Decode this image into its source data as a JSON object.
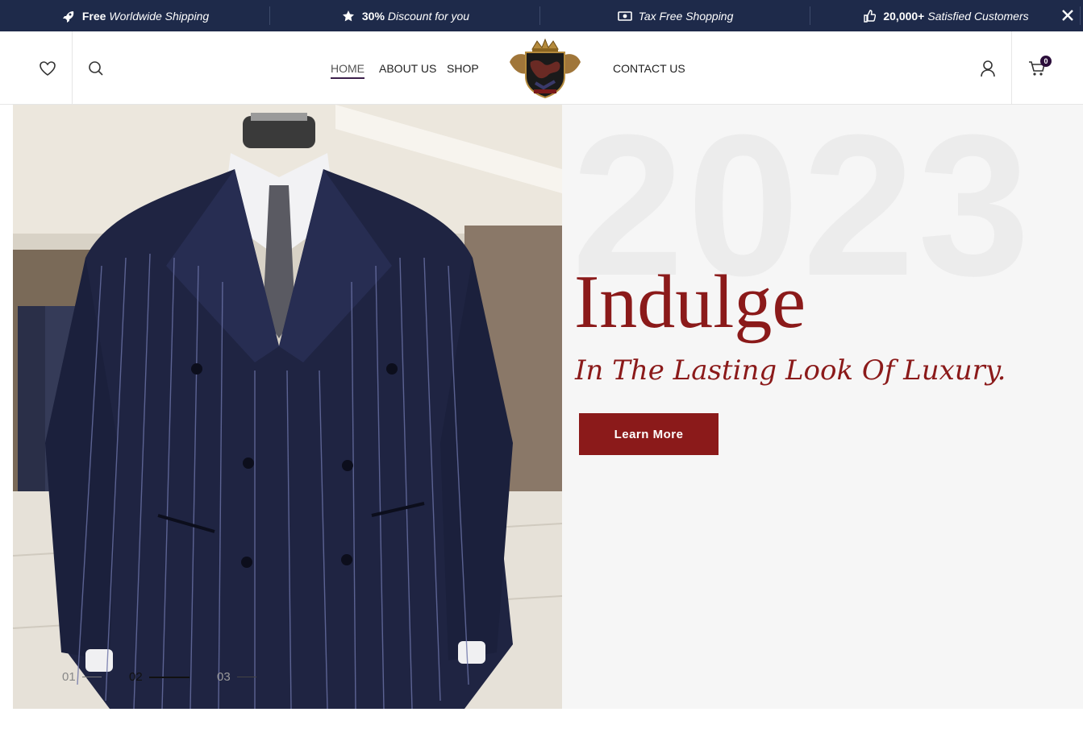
{
  "topbar": {
    "promos": [
      {
        "icon": "rocket-icon",
        "bold": "Free",
        "text": "Worldwide Shipping"
      },
      {
        "icon": "star-icon",
        "bold": "30%",
        "text": "Discount for you"
      },
      {
        "icon": "cash-icon",
        "bold": "",
        "text": "Tax Free Shopping"
      },
      {
        "icon": "thumbs-up-icon",
        "bold": "20,000+",
        "text": "Satisfied Customers"
      }
    ],
    "close_icon": "close-icon"
  },
  "nav": {
    "items": [
      {
        "label": "HOME",
        "active": true
      },
      {
        "label": "ABOUT US",
        "active": false
      },
      {
        "label": "SHOP",
        "active": false
      },
      {
        "label": "CONTACT US",
        "active": false
      }
    ]
  },
  "header": {
    "cart_count": "0",
    "icons": [
      "heart-icon",
      "search-icon",
      "user-icon",
      "cart-icon"
    ]
  },
  "hero": {
    "background_year": "2023",
    "headline": "Indulge",
    "subline": "In The Lasting Look Of Luxury.",
    "cta_label": "Learn More",
    "pager": [
      "01",
      "02",
      "03"
    ],
    "active_slide": 2
  },
  "colors": {
    "topbar_bg": "#1e2a4a",
    "accent": "#8b1a1a",
    "badge": "#2b0d3a"
  }
}
